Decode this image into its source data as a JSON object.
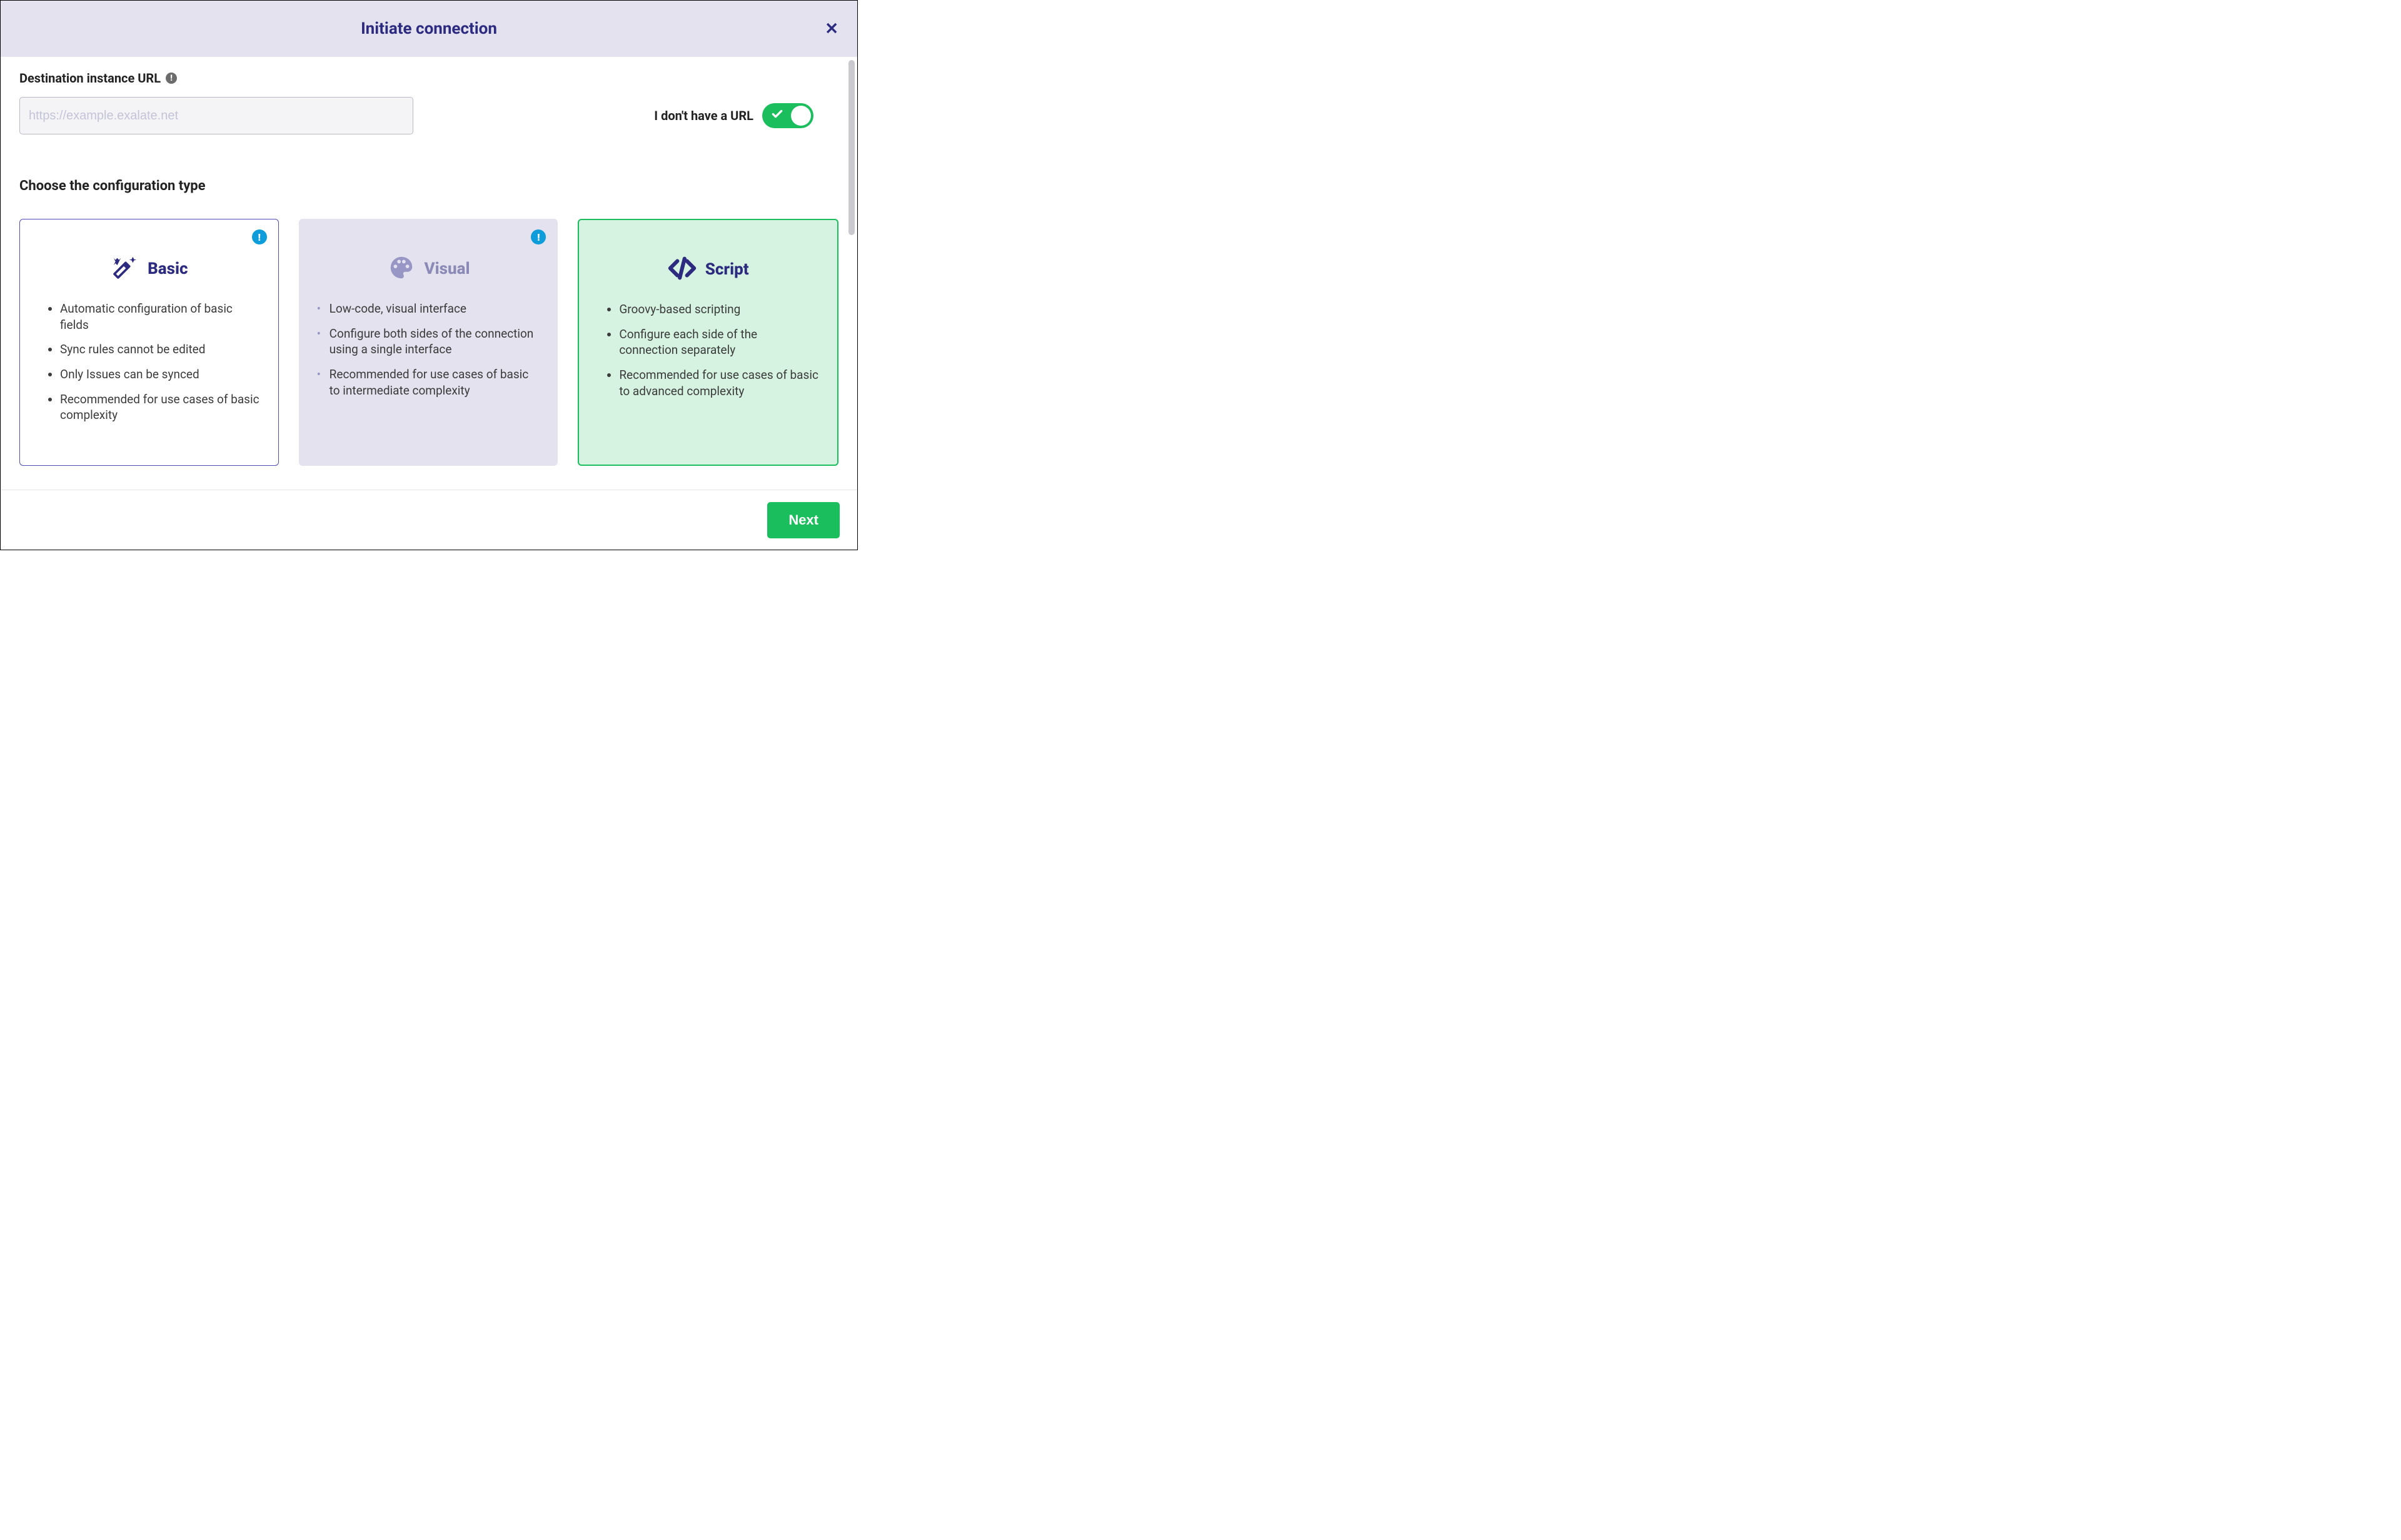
{
  "header": {
    "title": "Initiate connection",
    "close_glyph": "✕"
  },
  "url_section": {
    "label": "Destination instance URL",
    "placeholder": "https://example.exalate.net",
    "no_url_label": "I don't have a URL"
  },
  "config_section": {
    "heading": "Choose the configuration type"
  },
  "cards": {
    "basic": {
      "title": "Basic",
      "bullets": [
        "Automatic configuration of basic fields",
        "Sync rules cannot be edited",
        "Only Issues can be synced",
        "Recommended for use cases of basic complexity"
      ]
    },
    "visual": {
      "title": "Visual",
      "bullets": [
        "Low-code, visual interface",
        "Configure both sides of the connection using a single interface",
        "Recommended for use cases of basic to intermediate complexity"
      ]
    },
    "script": {
      "title": "Script",
      "bullets": [
        "Groovy-based scripting",
        "Configure each side of the connection separately",
        "Recommended for use cases of basic to advanced complexity"
      ]
    }
  },
  "footer": {
    "next_label": "Next"
  }
}
